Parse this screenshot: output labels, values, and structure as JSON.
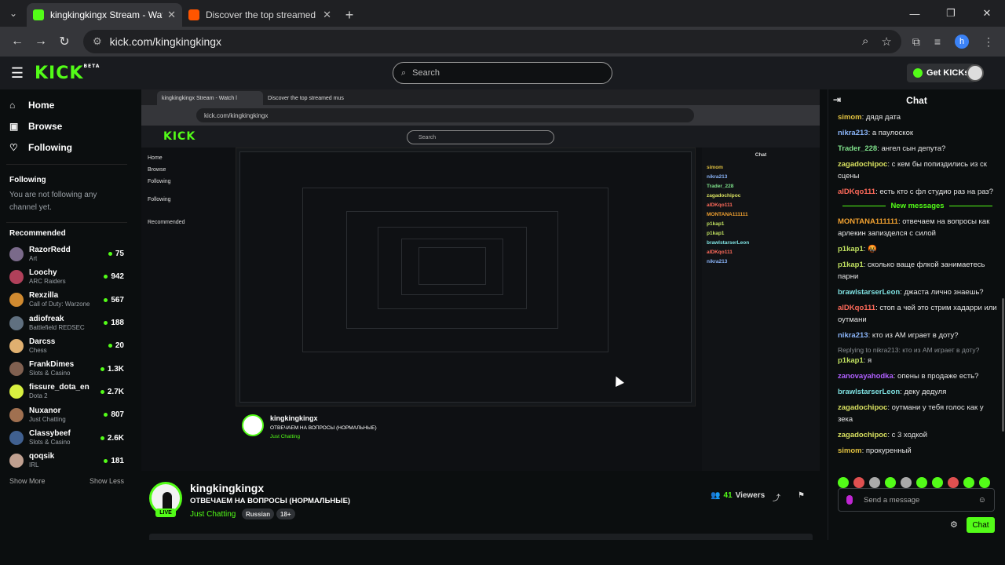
{
  "browser": {
    "tabs": [
      {
        "title": "kingkingkingx Stream - Watch l",
        "favicon_color": "#53fc18",
        "active": true
      },
      {
        "title": "Discover the top streamed mus",
        "favicon_color": "#ff5500",
        "active": false
      }
    ],
    "url": "kick.com/kingkingkingx",
    "profile_initial": "h"
  },
  "header": {
    "logo": "KICK",
    "logo_badge": "BETA",
    "search_placeholder": "Search",
    "get_kicks": "Get KICKs"
  },
  "sidebar": {
    "nav": [
      {
        "label": "Home",
        "icon": "home-icon",
        "glyph": "⌂"
      },
      {
        "label": "Browse",
        "icon": "browse-icon",
        "glyph": "▣"
      },
      {
        "label": "Following",
        "icon": "heart-icon",
        "glyph": "♡"
      }
    ],
    "following_title": "Following",
    "following_empty": "You are not following any channel yet.",
    "recommended_title": "Recommended",
    "recommended": [
      {
        "name": "RazorRedd",
        "category": "Art",
        "viewers": "75",
        "color": "#7a6a8a"
      },
      {
        "name": "Loochy",
        "category": "ARC Raiders",
        "viewers": "942",
        "color": "#b0405a"
      },
      {
        "name": "Rexzilla",
        "category": "Call of Duty: Warzone",
        "viewers": "567",
        "color": "#d08a30"
      },
      {
        "name": "adiofreak",
        "category": "Battlefield REDSEC",
        "viewers": "188",
        "color": "#607080"
      },
      {
        "name": "Darcss",
        "category": "Chess",
        "viewers": "20",
        "color": "#e0b070"
      },
      {
        "name": "FrankDimes",
        "category": "Slots & Casino",
        "viewers": "1.3K",
        "color": "#806050"
      },
      {
        "name": "fissure_dota_en",
        "category": "Dota 2",
        "viewers": "2.7K",
        "color": "#d8f040"
      },
      {
        "name": "Nuxanor",
        "category": "Just Chatting",
        "viewers": "807",
        "color": "#a07050"
      },
      {
        "name": "Classybeef",
        "category": "Slots & Casino",
        "viewers": "2.6K",
        "color": "#406090"
      },
      {
        "name": "qoqsik",
        "category": "IRL",
        "viewers": "181",
        "color": "#c0a090"
      }
    ],
    "show_more": "Show More",
    "show_less": "Show Less"
  },
  "stream": {
    "channel": "kingkingkingx",
    "title": "ОТВЕЧАЕМ НА ВОПРОСЫ (НОРМАЛЬНЫЕ)",
    "category": "Just Chatting",
    "tags": [
      "Russian",
      "18+"
    ],
    "live_label": "LIVE",
    "viewers": "41",
    "viewers_label": "Viewers"
  },
  "chat": {
    "title": "Chat",
    "new_messages_label": "New messages",
    "messages_before": [
      {
        "user": "simom",
        "color": "#e0c040",
        "text": "дядя дата"
      },
      {
        "user": "nikra213",
        "color": "#8ab4f8",
        "text": "а паулоскок"
      },
      {
        "user": "Trader_228",
        "color": "#7ee08a",
        "text": "ангел сын депута?"
      },
      {
        "user": "zagadochipoc",
        "color": "#d8e060",
        "text": "с кем бы попиздились из ск сцены"
      },
      {
        "user": "alDKqo111",
        "color": "#ff6a5a",
        "text": "есть кто с фл студио раз на раз?"
      }
    ],
    "messages_after": [
      {
        "user": "MONTANA111111",
        "color": "#f0a030",
        "text": "отвечаем на вопросы как арлекин запизделся с силой"
      },
      {
        "user": "p1kap1",
        "color": "#c0e060",
        "text": "🤬"
      },
      {
        "user": "p1kap1",
        "color": "#c0e060",
        "text": "сколько ваще флкой занимаетесь парни"
      },
      {
        "user": "brawlstarserLeon",
        "color": "#7ee0e0",
        "text": "джаста лично знаешь?"
      },
      {
        "user": "alDKqo111",
        "color": "#ff6a5a",
        "text": "стоп а чей это стрим хадарри или оутмани"
      },
      {
        "user": "nikra213",
        "color": "#8ab4f8",
        "text": "кто из АМ играет в доту?"
      }
    ],
    "reply_note": "Replying to nikra213: кто из АМ играет в доту?",
    "messages_after2": [
      {
        "user": "p1kap1",
        "color": "#c0e060",
        "text": "я"
      },
      {
        "user": "zanovayahodka",
        "color": "#b060ff",
        "text": "опены в продаже есть?"
      },
      {
        "user": "brawlstarserLeon",
        "color": "#7ee0e0",
        "text": "деку дедуля"
      },
      {
        "user": "zagadochipoc",
        "color": "#d8e060",
        "text": "оутмани у тебя голос как у зека"
      },
      {
        "user": "zagadochipoc",
        "color": "#d8e060",
        "text": "с 3 ходкой"
      },
      {
        "user": "simom",
        "color": "#e0c040",
        "text": "прокуренный"
      }
    ],
    "input_placeholder": "Send a message",
    "send_label": "Chat"
  }
}
